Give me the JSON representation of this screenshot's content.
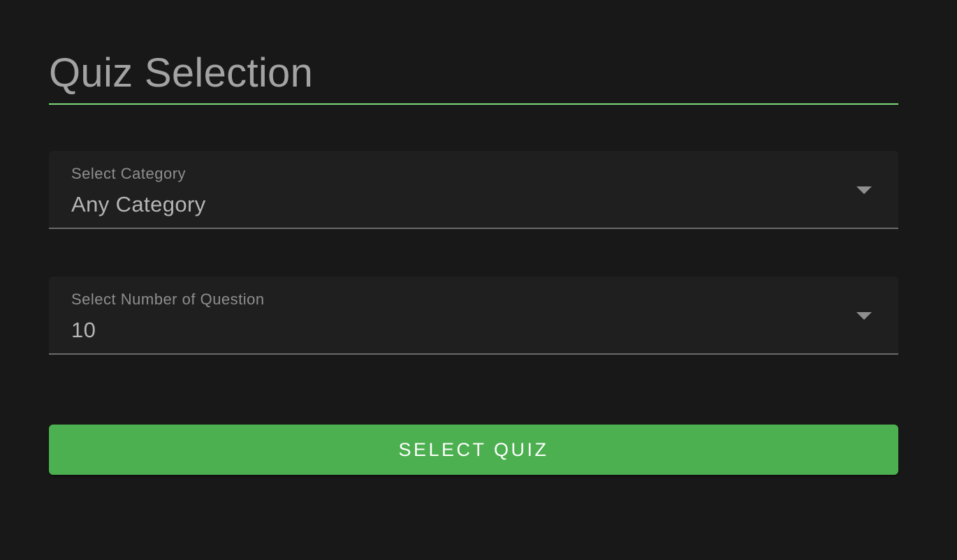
{
  "header": {
    "title": "Quiz Selection"
  },
  "form": {
    "category": {
      "label": "Select Category",
      "value": "Any Category"
    },
    "question_count": {
      "label": "Select Number of Question",
      "value": "10"
    },
    "submit_label": "SELECT QUIZ"
  },
  "colors": {
    "background": "#181818",
    "field_background": "#1f1f1f",
    "accent_green": "#4caf50",
    "title_underline": "#7dd87d"
  },
  "icons": {
    "dropdown": "chevron-down-icon"
  }
}
